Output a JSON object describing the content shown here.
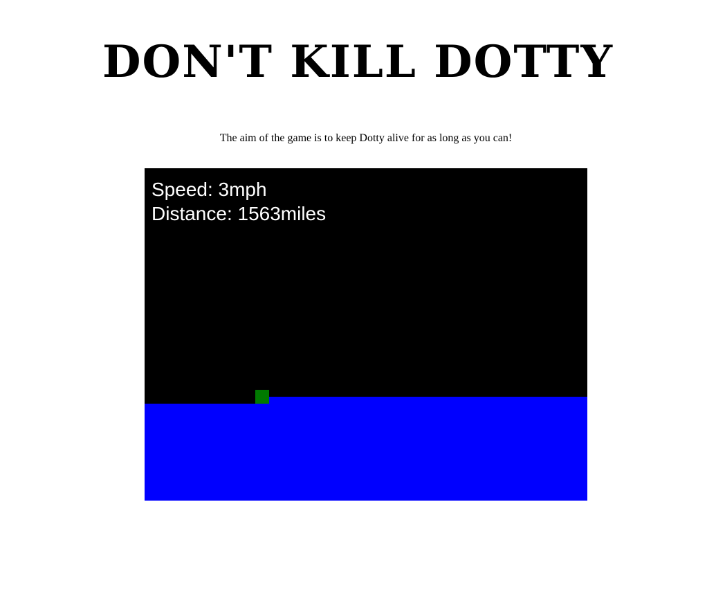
{
  "header": {
    "title": "DON'T KILL DOTTY",
    "subtitle": "The aim of the game is to keep Dotty alive for as long as you can!"
  },
  "hud": {
    "speed_label": "Speed: ",
    "speed_value": "3mph",
    "distance_label": "Distance: ",
    "distance_value": "1563miles"
  },
  "colors": {
    "sky": "#000000",
    "ground": "#0000ff",
    "dotty": "#007a00",
    "hud_text": "#ffffff"
  }
}
